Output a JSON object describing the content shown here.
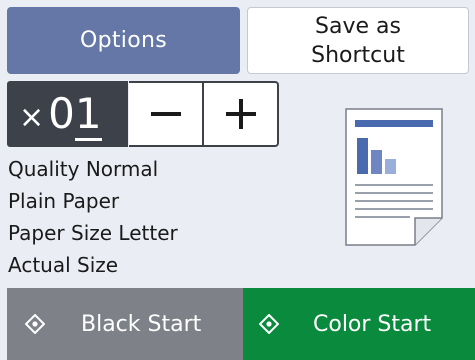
{
  "top_buttons": {
    "options_label": "Options",
    "shortcut_label_line1": "Save as",
    "shortcut_label_line2": "Shortcut"
  },
  "copies": {
    "times_symbol": "×",
    "count_tens": "0",
    "count_ones": "1",
    "minus_label": "−",
    "plus_label": "+"
  },
  "settings": [
    "Quality Normal",
    "Plain Paper",
    "Paper Size Letter",
    "Actual Size"
  ],
  "preview": {
    "icon": "document-preview-icon",
    "accent_color": "#4a6ab0"
  },
  "start_buttons": {
    "black_label": "Black Start",
    "color_label": "Color Start",
    "black_color": "#7e8188",
    "color_color": "#0a8a3c"
  },
  "colors": {
    "background": "#eaedf3",
    "options_button": "#6477a6",
    "counter_dark": "#3d414a"
  }
}
